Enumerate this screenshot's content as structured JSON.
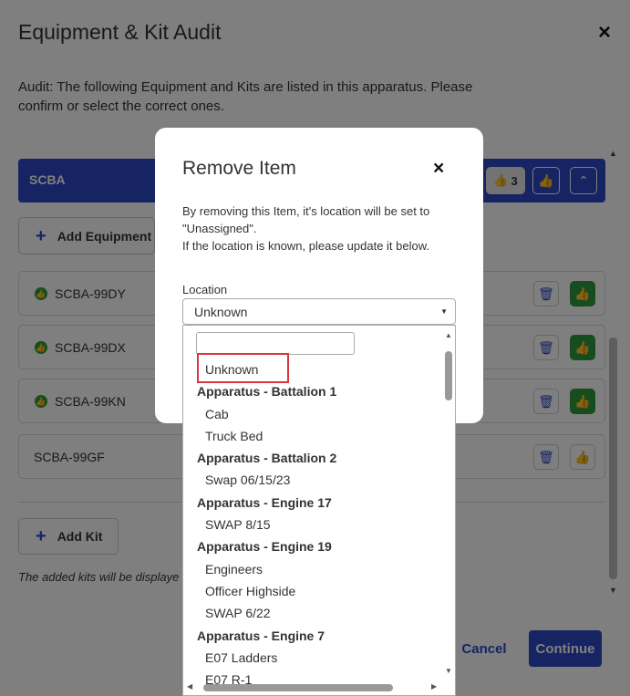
{
  "page": {
    "title": "Equipment & Kit Audit",
    "close_icon": "×",
    "description": "Audit: The following Equipment and Kits are listed in this apparatus. Please confirm or select the correct ones."
  },
  "scba": {
    "label": "SCBA",
    "count": "3",
    "thumb_icon": "👍",
    "collapse_icon": "⌃"
  },
  "add_equipment_label": "Add Equipment",
  "equipment": [
    {
      "name": "SCBA-99DY",
      "confirmed": true
    },
    {
      "name": "SCBA-99DX",
      "confirmed": true
    },
    {
      "name": "SCBA-99KN",
      "confirmed": true
    },
    {
      "name": "SCBA-99GF",
      "confirmed": false
    }
  ],
  "add_kit_label": "Add Kit",
  "kits_note": "The added kits will be displaye",
  "footer": {
    "cancel_label": "Cancel",
    "continue_label": "Continue"
  },
  "modal": {
    "title": "Remove Item",
    "close_icon": "×",
    "line1": "By removing this Item, it's location will be set to \"Unassigned\".",
    "line2": "If the location is known, please update it below.",
    "location_label": "Location",
    "location_value": "Unknown"
  },
  "dropdown": {
    "search_value": "",
    "items": [
      {
        "type": "option",
        "label": "Unknown"
      },
      {
        "type": "group",
        "label": "Apparatus - Battalion 1"
      },
      {
        "type": "option",
        "label": "Cab"
      },
      {
        "type": "option",
        "label": "Truck Bed"
      },
      {
        "type": "group",
        "label": "Apparatus - Battalion 2"
      },
      {
        "type": "option",
        "label": "Swap 06/15/23"
      },
      {
        "type": "group",
        "label": "Apparatus - Engine 17"
      },
      {
        "type": "option",
        "label": "SWAP 8/15"
      },
      {
        "type": "group",
        "label": "Apparatus - Engine 19"
      },
      {
        "type": "option",
        "label": "Engineers"
      },
      {
        "type": "option",
        "label": "Officer Highside"
      },
      {
        "type": "option",
        "label": "SWAP 6/22"
      },
      {
        "type": "group",
        "label": "Apparatus - Engine 7"
      },
      {
        "type": "option",
        "label": "E07 Ladders"
      },
      {
        "type": "option",
        "label": "E07 R-1"
      }
    ]
  },
  "colors": {
    "primary": "#2c49c8",
    "success": "#2e9a3c",
    "highlight": "#d9363e"
  }
}
